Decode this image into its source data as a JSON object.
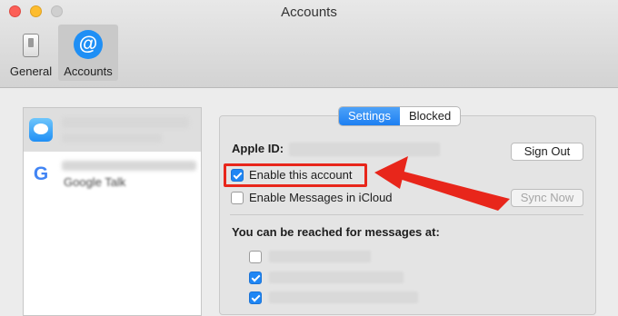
{
  "window": {
    "title": "Accounts"
  },
  "toolbar": {
    "items": [
      {
        "label": "General",
        "icon": "general-switch-icon"
      },
      {
        "label": "Accounts",
        "icon": "at-sign-icon"
      }
    ]
  },
  "accounts": {
    "items": [
      {
        "icon": "imessage-icon",
        "selected": true
      },
      {
        "icon": "google-icon",
        "subtitle": "Google Talk",
        "selected": false
      }
    ]
  },
  "tabs": {
    "settings": "Settings",
    "blocked": "Blocked"
  },
  "settings": {
    "apple_id_label": "Apple ID:",
    "sign_out": "Sign Out",
    "enable_account": "Enable this account",
    "enable_account_checked": true,
    "enable_icloud": "Enable Messages in iCloud",
    "enable_icloud_checked": false,
    "sync_now": "Sync Now",
    "reach_label": "You can be reached for messages at:",
    "reach_addresses": [
      {
        "checked": false
      },
      {
        "checked": true
      },
      {
        "checked": true
      }
    ]
  },
  "colors": {
    "accent": "#1f86f4",
    "annotation": "#e8261b"
  }
}
